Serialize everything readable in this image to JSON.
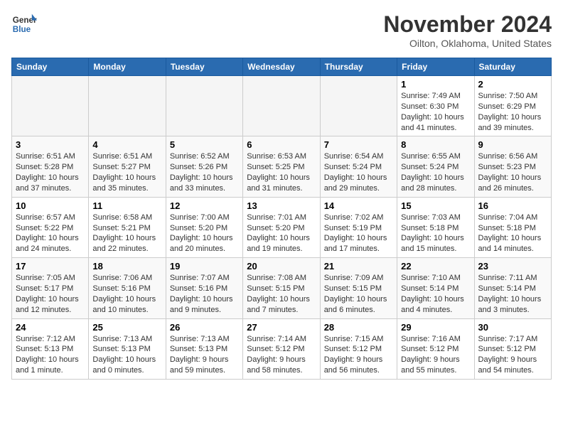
{
  "logo": {
    "general": "General",
    "blue": "Blue"
  },
  "title": "November 2024",
  "location": "Oilton, Oklahoma, United States",
  "weekdays": [
    "Sunday",
    "Monday",
    "Tuesday",
    "Wednesday",
    "Thursday",
    "Friday",
    "Saturday"
  ],
  "weeks": [
    [
      {
        "day": "",
        "info": ""
      },
      {
        "day": "",
        "info": ""
      },
      {
        "day": "",
        "info": ""
      },
      {
        "day": "",
        "info": ""
      },
      {
        "day": "",
        "info": ""
      },
      {
        "day": "1",
        "info": "Sunrise: 7:49 AM\nSunset: 6:30 PM\nDaylight: 10 hours and 41 minutes."
      },
      {
        "day": "2",
        "info": "Sunrise: 7:50 AM\nSunset: 6:29 PM\nDaylight: 10 hours and 39 minutes."
      }
    ],
    [
      {
        "day": "3",
        "info": "Sunrise: 6:51 AM\nSunset: 5:28 PM\nDaylight: 10 hours and 37 minutes."
      },
      {
        "day": "4",
        "info": "Sunrise: 6:51 AM\nSunset: 5:27 PM\nDaylight: 10 hours and 35 minutes."
      },
      {
        "day": "5",
        "info": "Sunrise: 6:52 AM\nSunset: 5:26 PM\nDaylight: 10 hours and 33 minutes."
      },
      {
        "day": "6",
        "info": "Sunrise: 6:53 AM\nSunset: 5:25 PM\nDaylight: 10 hours and 31 minutes."
      },
      {
        "day": "7",
        "info": "Sunrise: 6:54 AM\nSunset: 5:24 PM\nDaylight: 10 hours and 29 minutes."
      },
      {
        "day": "8",
        "info": "Sunrise: 6:55 AM\nSunset: 5:24 PM\nDaylight: 10 hours and 28 minutes."
      },
      {
        "day": "9",
        "info": "Sunrise: 6:56 AM\nSunset: 5:23 PM\nDaylight: 10 hours and 26 minutes."
      }
    ],
    [
      {
        "day": "10",
        "info": "Sunrise: 6:57 AM\nSunset: 5:22 PM\nDaylight: 10 hours and 24 minutes."
      },
      {
        "day": "11",
        "info": "Sunrise: 6:58 AM\nSunset: 5:21 PM\nDaylight: 10 hours and 22 minutes."
      },
      {
        "day": "12",
        "info": "Sunrise: 7:00 AM\nSunset: 5:20 PM\nDaylight: 10 hours and 20 minutes."
      },
      {
        "day": "13",
        "info": "Sunrise: 7:01 AM\nSunset: 5:20 PM\nDaylight: 10 hours and 19 minutes."
      },
      {
        "day": "14",
        "info": "Sunrise: 7:02 AM\nSunset: 5:19 PM\nDaylight: 10 hours and 17 minutes."
      },
      {
        "day": "15",
        "info": "Sunrise: 7:03 AM\nSunset: 5:18 PM\nDaylight: 10 hours and 15 minutes."
      },
      {
        "day": "16",
        "info": "Sunrise: 7:04 AM\nSunset: 5:18 PM\nDaylight: 10 hours and 14 minutes."
      }
    ],
    [
      {
        "day": "17",
        "info": "Sunrise: 7:05 AM\nSunset: 5:17 PM\nDaylight: 10 hours and 12 minutes."
      },
      {
        "day": "18",
        "info": "Sunrise: 7:06 AM\nSunset: 5:16 PM\nDaylight: 10 hours and 10 minutes."
      },
      {
        "day": "19",
        "info": "Sunrise: 7:07 AM\nSunset: 5:16 PM\nDaylight: 10 hours and 9 minutes."
      },
      {
        "day": "20",
        "info": "Sunrise: 7:08 AM\nSunset: 5:15 PM\nDaylight: 10 hours and 7 minutes."
      },
      {
        "day": "21",
        "info": "Sunrise: 7:09 AM\nSunset: 5:15 PM\nDaylight: 10 hours and 6 minutes."
      },
      {
        "day": "22",
        "info": "Sunrise: 7:10 AM\nSunset: 5:14 PM\nDaylight: 10 hours and 4 minutes."
      },
      {
        "day": "23",
        "info": "Sunrise: 7:11 AM\nSunset: 5:14 PM\nDaylight: 10 hours and 3 minutes."
      }
    ],
    [
      {
        "day": "24",
        "info": "Sunrise: 7:12 AM\nSunset: 5:13 PM\nDaylight: 10 hours and 1 minute."
      },
      {
        "day": "25",
        "info": "Sunrise: 7:13 AM\nSunset: 5:13 PM\nDaylight: 10 hours and 0 minutes."
      },
      {
        "day": "26",
        "info": "Sunrise: 7:13 AM\nSunset: 5:13 PM\nDaylight: 9 hours and 59 minutes."
      },
      {
        "day": "27",
        "info": "Sunrise: 7:14 AM\nSunset: 5:12 PM\nDaylight: 9 hours and 58 minutes."
      },
      {
        "day": "28",
        "info": "Sunrise: 7:15 AM\nSunset: 5:12 PM\nDaylight: 9 hours and 56 minutes."
      },
      {
        "day": "29",
        "info": "Sunrise: 7:16 AM\nSunset: 5:12 PM\nDaylight: 9 hours and 55 minutes."
      },
      {
        "day": "30",
        "info": "Sunrise: 7:17 AM\nSunset: 5:12 PM\nDaylight: 9 hours and 54 minutes."
      }
    ]
  ]
}
